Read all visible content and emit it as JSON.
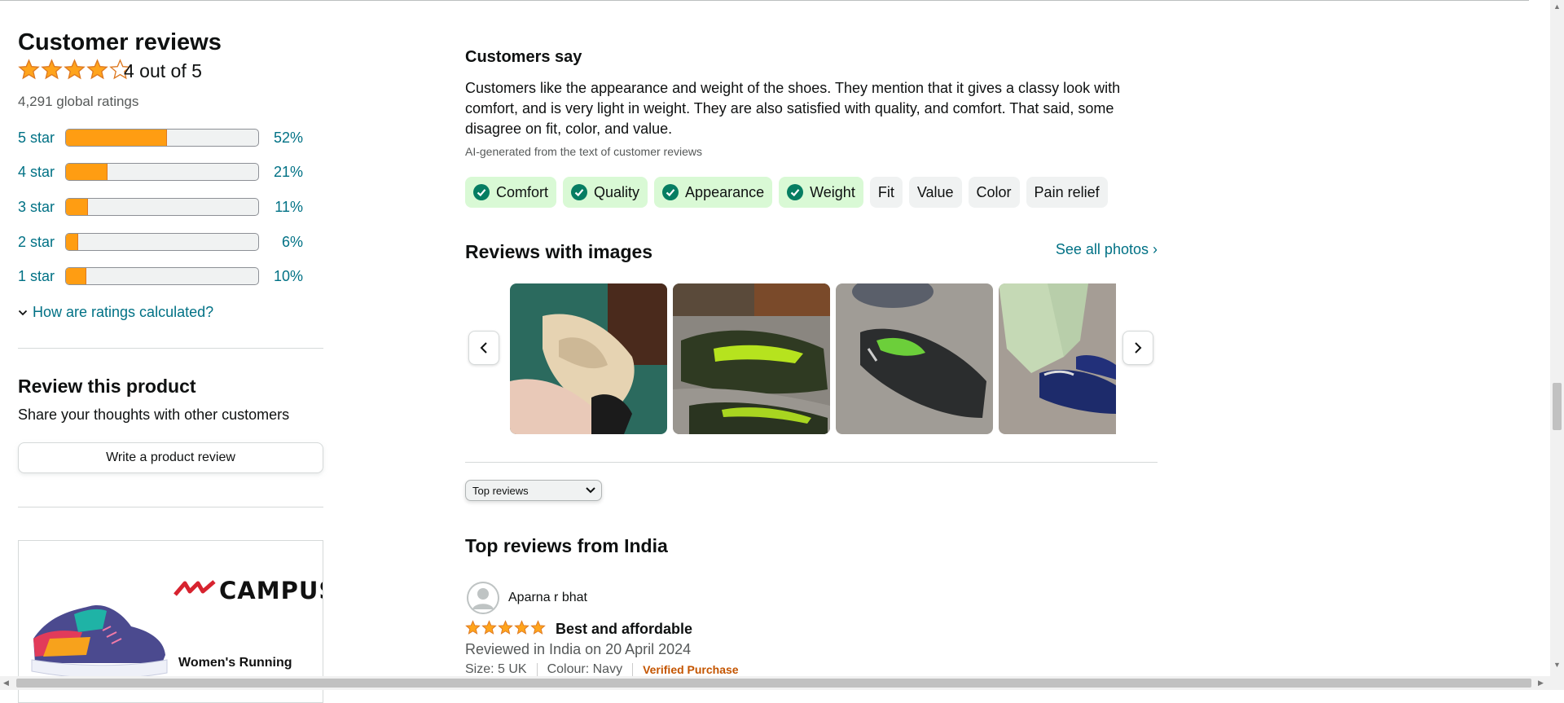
{
  "summary": {
    "title": "Customer reviews",
    "rating": 4,
    "rating_text": "4 out of 5",
    "global_ratings": "4,291 global ratings",
    "histogram": [
      {
        "label": "5 star",
        "pct": 52,
        "pct_text": "52%"
      },
      {
        "label": "4 star",
        "pct": 21,
        "pct_text": "21%"
      },
      {
        "label": "3 star",
        "pct": 11,
        "pct_text": "11%"
      },
      {
        "label": "2 star",
        "pct": 6,
        "pct_text": "6%"
      },
      {
        "label": "1 star",
        "pct": 10,
        "pct_text": "10%"
      }
    ],
    "how_calculated": "How are ratings calculated?"
  },
  "review_product": {
    "title": "Review this product",
    "subtitle": "Share your thoughts with other customers",
    "button": "Write a product review"
  },
  "ad": {
    "brand": "CAMPUS",
    "registered": "®",
    "text": "Women's Running"
  },
  "customers_say": {
    "title": "Customers say",
    "body": "Customers like the appearance and weight of the shoes. They mention that it gives a classy look with comfort, and is very light in weight. They are also satisfied with quality, and comfort. That said, some disagree on fit, color, and value.",
    "ai_note": "AI-generated from the text of customer reviews",
    "chips": [
      {
        "label": "Comfort",
        "positive": true
      },
      {
        "label": "Quality",
        "positive": true
      },
      {
        "label": "Appearance",
        "positive": true
      },
      {
        "label": "Weight",
        "positive": true
      },
      {
        "label": "Fit",
        "positive": false
      },
      {
        "label": "Value",
        "positive": false
      },
      {
        "label": "Color",
        "positive": false
      },
      {
        "label": "Pain relief",
        "positive": false
      }
    ]
  },
  "reviews_with_images": {
    "title": "Reviews with images",
    "see_all": "See all photos",
    "see_all_arrow": "›"
  },
  "sort": {
    "selected": "Top reviews"
  },
  "top_reviews": {
    "title": "Top reviews from India",
    "reviews": [
      {
        "reviewer": "Aparna r bhat",
        "rating": 5,
        "title": "Best and affordable",
        "date": "Reviewed in India on 20 April 2024",
        "size": "Size: 5 UK",
        "colour": "Colour: Navy",
        "verified": "Verified Purchase"
      }
    ]
  },
  "colors": {
    "link": "#007185",
    "star": "#ffa41c",
    "bar_fill": "#ff9d12",
    "chip_positive": "#d9f9d5",
    "check": "#067d62",
    "verified": "#c45500"
  }
}
